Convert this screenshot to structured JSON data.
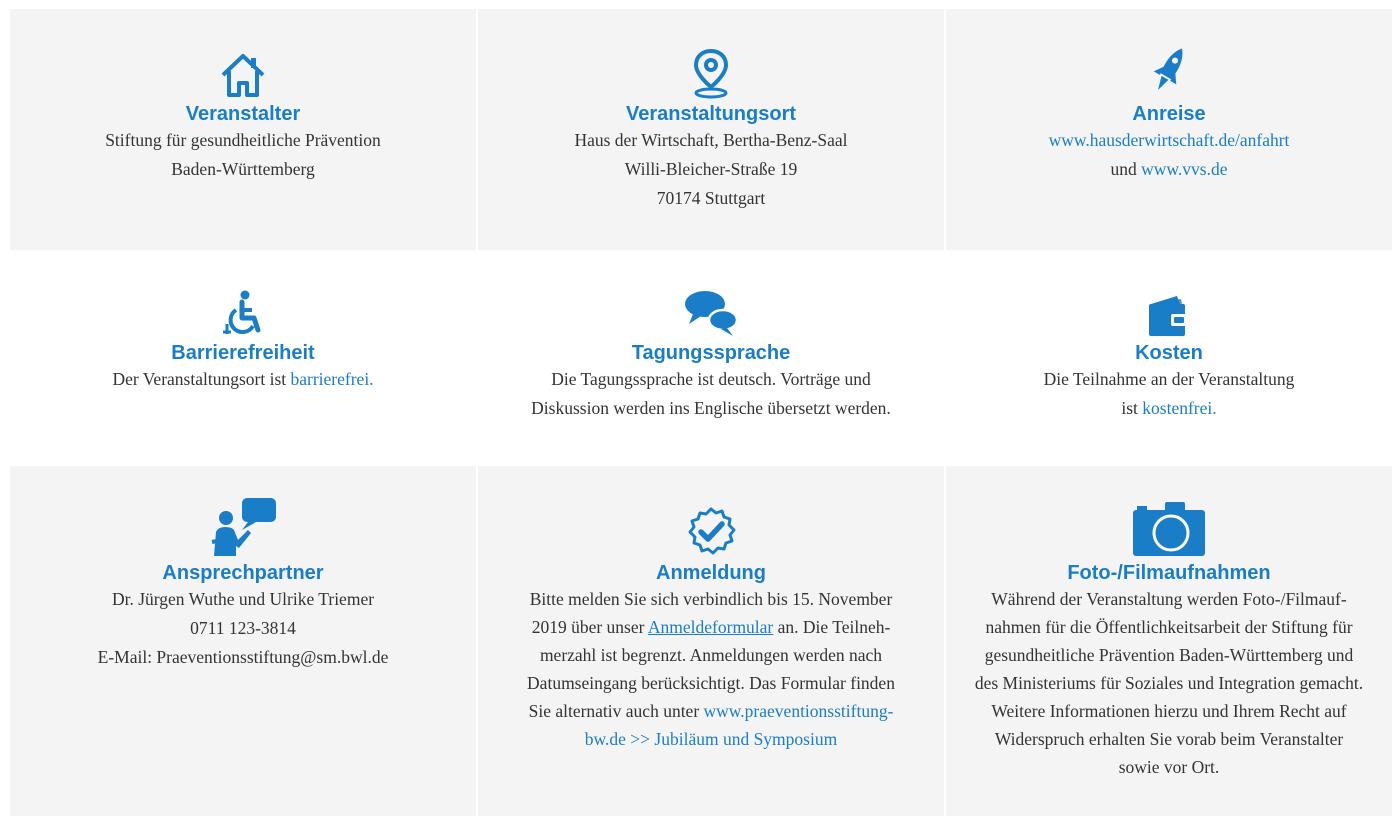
{
  "colors": {
    "accent": "#1a7dc8",
    "panel_bg": "#f4f4f4",
    "text": "#333333"
  },
  "cells": [
    {
      "icon": "house-icon",
      "title": "Veranstalter",
      "lines": [
        "Stiftung für gesundheitliche Prävention",
        "Baden-Württemberg"
      ]
    },
    {
      "icon": "location-pin-icon",
      "title": "Veranstaltungsort",
      "lines": [
        "Haus der Wirtschaft, Bertha-Benz-Saal",
        "Willi-Bleicher-Straße 19",
        "70174 Stuttgart"
      ]
    },
    {
      "icon": "rocket-icon",
      "title": "Anreise",
      "link1": "www.hausderwirtschaft.de/anfahrt",
      "and": "und",
      "link2": "www.vvs.de"
    },
    {
      "icon": "wheelchair-icon",
      "title": "Barrierefreiheit",
      "text": "Der Veranstaltungsort ist",
      "link": "barrierefrei."
    },
    {
      "icon": "speech-bubbles-icon",
      "title": "Tagungssprache",
      "lines": [
        "Die Tagungssprache ist deutsch. Vorträge und",
        "Diskussion werden ins Englische übersetzt werden."
      ]
    },
    {
      "icon": "wallet-icon",
      "title": "Kosten",
      "line1": "Die Teilnahme an der Veranstaltung",
      "line2_pre": "ist",
      "link": "kostenfrei."
    },
    {
      "icon": "person-speaking-icon",
      "title": "Ansprechpartner",
      "lines": [
        "Dr. Jürgen Wuthe und Ulrike Triemer",
        "0711 123-3814",
        "E-Mail: Praeventionsstiftung@sm.bwl.de"
      ]
    },
    {
      "icon": "check-badge-icon",
      "title": "Anmeldung",
      "l1": "Bitte melden Sie sich verbindlich bis 15. November",
      "l2_pre": "2019 über unser",
      "l2_link": "Anmeldeformular",
      "l2_post": "an. Die Teilneh-",
      "l3": "merzahl ist begrenzt. Anmeldungen werden nach",
      "l4": "Datumseingang berücksichtigt. Das Formular finden",
      "l5_pre": "Sie alternativ auch unter",
      "l5_link": "www.praeventionsstiftung-",
      "l6_link": "bw.de >> Jubiläum und Symposium"
    },
    {
      "icon": "camera-icon",
      "title": "Foto-/Filmaufnahmen",
      "lines": [
        "Während der Veranstaltung werden Foto-/Filmauf-",
        "nahmen für die Öffentlichkeitsarbeit der Stiftung für",
        "gesundheitliche Prävention Baden-Württemberg und",
        "des Ministeriums für Soziales und Integration gemacht.",
        "Weitere Informationen hierzu und Ihrem Recht auf",
        "Widerspruch erhalten Sie vorab beim Veranstalter",
        "sowie vor Ort."
      ]
    }
  ]
}
